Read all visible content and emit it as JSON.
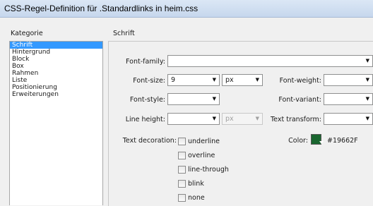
{
  "window": {
    "title": "CSS-Regel-Definition für .Standardlinks in heim.css"
  },
  "sidebar": {
    "heading": "Kategorie",
    "items": [
      {
        "label": "Schrift",
        "selected": true
      },
      {
        "label": "Hintergrund"
      },
      {
        "label": "Block"
      },
      {
        "label": "Box"
      },
      {
        "label": "Rahmen"
      },
      {
        "label": "Liste"
      },
      {
        "label": "Positionierung"
      },
      {
        "label": "Erweiterungen"
      }
    ]
  },
  "section": {
    "title": "Schrift"
  },
  "fields": {
    "font_family": {
      "label": "Font-family:",
      "value": ""
    },
    "font_size": {
      "label": "Font-size:",
      "value": "9",
      "unit": "px"
    },
    "font_weight": {
      "label": "Font-weight:",
      "value": ""
    },
    "font_style": {
      "label": "Font-style:",
      "value": ""
    },
    "font_variant": {
      "label": "Font-variant:",
      "value": ""
    },
    "line_height": {
      "label": "Line height:",
      "value": "",
      "unit": "px"
    },
    "text_transform": {
      "label": "Text transform:",
      "value": ""
    },
    "text_decoration": {
      "label": "Text decoration:",
      "options": [
        "underline",
        "overline",
        "line-through",
        "blink",
        "none"
      ]
    },
    "color": {
      "label": "Color:",
      "value": "#19662F",
      "swatch": "#19662f"
    }
  },
  "icons": {
    "dropdown": "▼"
  }
}
